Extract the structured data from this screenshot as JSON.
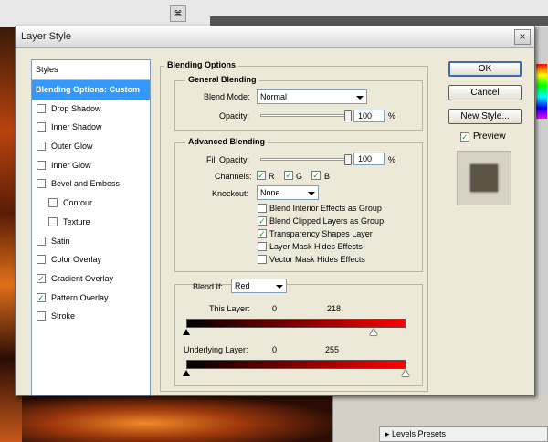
{
  "window": {
    "title": "Layer Style",
    "close_glyph": "×"
  },
  "styles_panel": {
    "header": "Styles",
    "items": [
      {
        "label": "Blending Options: Custom",
        "checkbox": false,
        "checked": false,
        "selected": true,
        "indent": false
      },
      {
        "label": "Drop Shadow",
        "checkbox": true,
        "checked": false,
        "selected": false,
        "indent": false
      },
      {
        "label": "Inner Shadow",
        "checkbox": true,
        "checked": false,
        "selected": false,
        "indent": false
      },
      {
        "label": "Outer Glow",
        "checkbox": true,
        "checked": false,
        "selected": false,
        "indent": false
      },
      {
        "label": "Inner Glow",
        "checkbox": true,
        "checked": false,
        "selected": false,
        "indent": false
      },
      {
        "label": "Bevel and Emboss",
        "checkbox": true,
        "checked": false,
        "selected": false,
        "indent": false
      },
      {
        "label": "Contour",
        "checkbox": true,
        "checked": false,
        "selected": false,
        "indent": true
      },
      {
        "label": "Texture",
        "checkbox": true,
        "checked": false,
        "selected": false,
        "indent": true
      },
      {
        "label": "Satin",
        "checkbox": true,
        "checked": false,
        "selected": false,
        "indent": false
      },
      {
        "label": "Color Overlay",
        "checkbox": true,
        "checked": false,
        "selected": false,
        "indent": false
      },
      {
        "label": "Gradient Overlay",
        "checkbox": true,
        "checked": true,
        "selected": false,
        "indent": false
      },
      {
        "label": "Pattern Overlay",
        "checkbox": true,
        "checked": true,
        "selected": false,
        "indent": false
      },
      {
        "label": "Stroke",
        "checkbox": true,
        "checked": false,
        "selected": false,
        "indent": false
      }
    ]
  },
  "blending": {
    "section_title": "Blending Options",
    "general": {
      "title": "General Blending",
      "blend_mode_label": "Blend Mode:",
      "blend_mode_value": "Normal",
      "opacity_label": "Opacity:",
      "opacity_value": "100",
      "opacity_unit": "%",
      "opacity_level": 1.0
    },
    "advanced": {
      "title": "Advanced Blending",
      "fill_opacity_label": "Fill Opacity:",
      "fill_opacity_value": "100",
      "fill_opacity_unit": "%",
      "fill_opacity_level": 1.0,
      "channels_label": "Channels:",
      "channels": [
        {
          "label": "R",
          "checked": true
        },
        {
          "label": "G",
          "checked": true
        },
        {
          "label": "B",
          "checked": true
        }
      ],
      "knockout_label": "Knockout:",
      "knockout_value": "None",
      "options": [
        {
          "label": "Blend Interior Effects as Group",
          "checked": false
        },
        {
          "label": "Blend Clipped Layers as Group",
          "checked": true
        },
        {
          "label": "Transparency Shapes Layer",
          "checked": true
        },
        {
          "label": "Layer Mask Hides Effects",
          "checked": false
        },
        {
          "label": "Vector Mask Hides Effects",
          "checked": false
        }
      ]
    },
    "blend_if": {
      "label": "Blend If:",
      "value": "Red",
      "this_layer": {
        "label": "This Layer:",
        "low": "0",
        "high": "218",
        "low_value": 0,
        "high_value": 218
      },
      "underlying_layer": {
        "label": "Underlying Layer:",
        "low": "0",
        "high": "255",
        "low_value": 0,
        "high_value": 255
      },
      "gradient_from": "#000000",
      "gradient_to": "#ff0000"
    }
  },
  "buttons": {
    "ok": "OK",
    "cancel": "Cancel",
    "new_style": "New Style...",
    "preview_label": "Preview",
    "preview_checked": true
  },
  "background": {
    "levels_presets": "Levels Presets",
    "checkmark": "✓"
  }
}
